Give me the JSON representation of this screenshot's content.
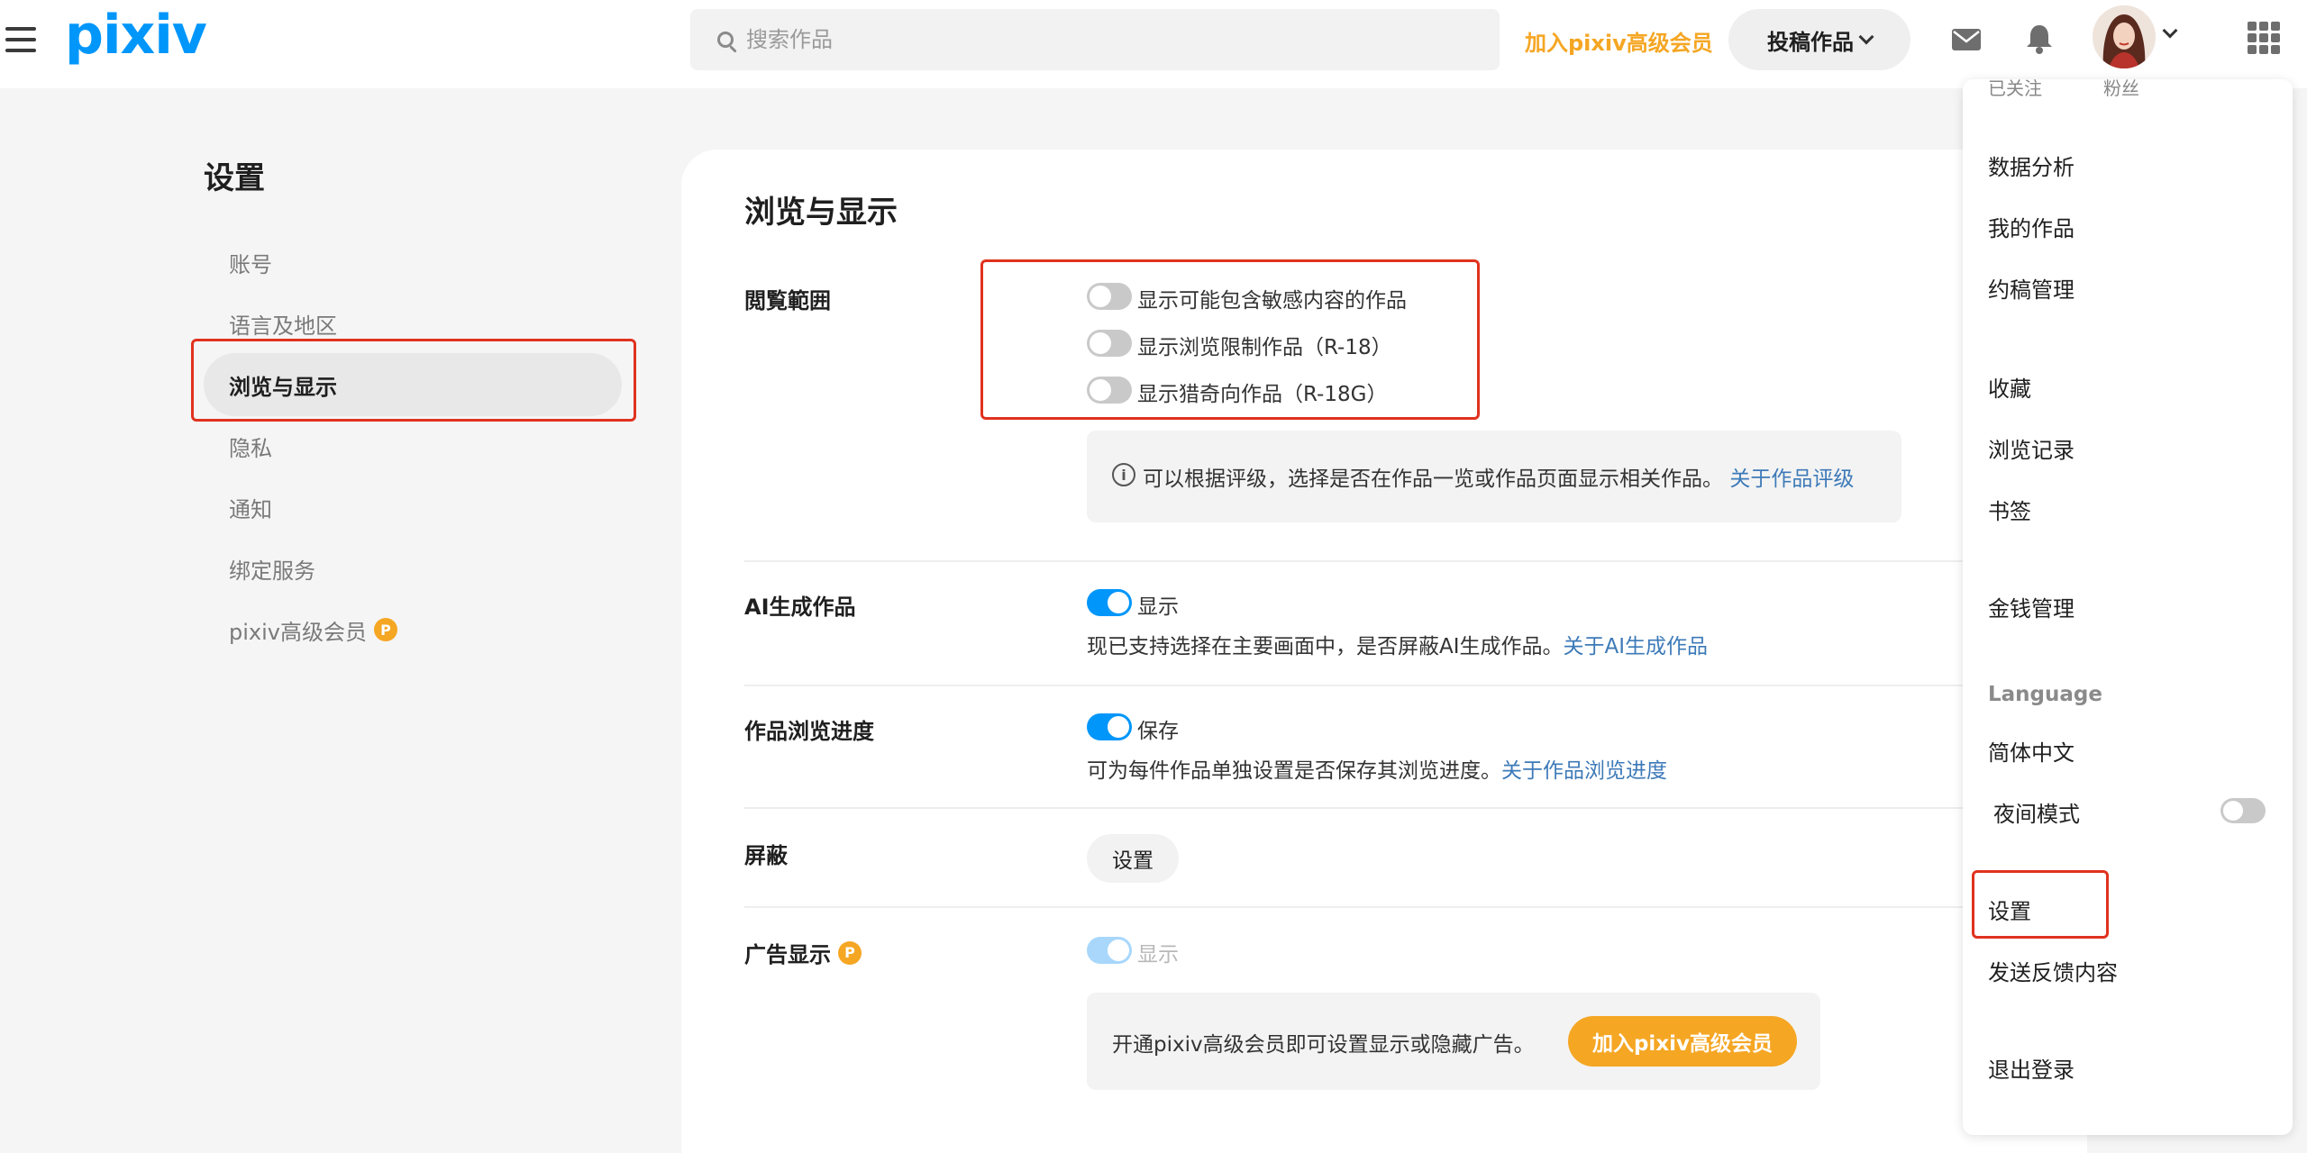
{
  "header": {
    "logo": "pixiv",
    "search_placeholder": "搜索作品",
    "premium_link": "加入pixiv高级会员",
    "post_button": "投稿作品"
  },
  "sidebar": {
    "title": "设置",
    "items": [
      {
        "label": "账号"
      },
      {
        "label": "语言及地区"
      },
      {
        "label": "浏览与显示"
      },
      {
        "label": "隐私"
      },
      {
        "label": "通知"
      },
      {
        "label": "绑定服务"
      },
      {
        "label": "pixiv高级会员",
        "badge": "P"
      }
    ]
  },
  "main": {
    "title": "浏览与显示",
    "browse_range": {
      "label": "閲覧範囲",
      "options": [
        {
          "label": "显示可能包含敏感内容的作品",
          "state": "off"
        },
        {
          "label": "显示浏览限制作品（R-18）",
          "state": "off"
        },
        {
          "label": "显示猎奇向作品（R-18G）",
          "state": "off"
        }
      ],
      "info_text": "可以根据评级，选择是否在作品一览或作品页面显示相关作品。",
      "info_link": "关于作品评级"
    },
    "ai_works": {
      "label": "AI生成作品",
      "toggle_label": "显示",
      "state": "on",
      "desc": "现已支持选择在主要画面中，是否屏蔽AI生成作品。",
      "link": "关于AI生成作品"
    },
    "progress": {
      "label": "作品浏览进度",
      "toggle_label": "保存",
      "state": "on",
      "desc": "可为每件作品单独设置是否保存其浏览进度。",
      "link": "关于作品浏览进度"
    },
    "mute": {
      "label": "屏蔽",
      "button": "设置"
    },
    "ads": {
      "label": "广告显示",
      "badge": "P",
      "toggle_label": "显示",
      "state": "on-disabled",
      "note": "开通pixiv高级会员即可设置显示或隐藏广告。",
      "button": "加入pixiv高级会员"
    }
  },
  "dropdown": {
    "top_left": "已关注",
    "top_right": "粉丝",
    "items": [
      "数据分析",
      "我的作品",
      "约稿管理",
      "收藏",
      "浏览记录",
      "书签",
      "金钱管理"
    ],
    "language_heading": "Language",
    "language_value": "简体中文",
    "night_mode": "夜间模式",
    "night_mode_state": "off",
    "settings": "设置",
    "feedback": "发送反馈内容",
    "logout": "退出登录"
  }
}
